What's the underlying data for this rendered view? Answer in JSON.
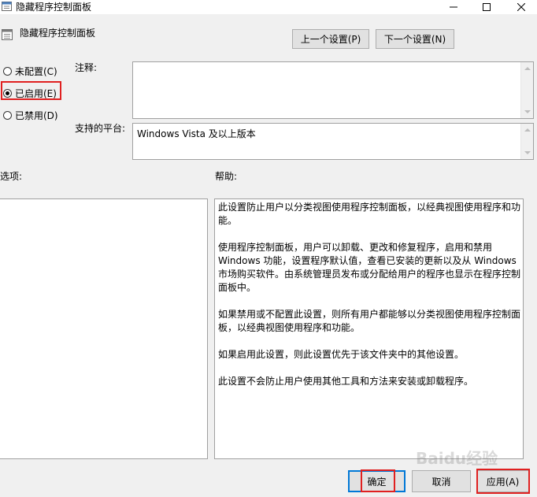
{
  "window": {
    "title": "隐藏程序控制面板",
    "controls": [
      "minimize-icon",
      "maximize-icon",
      "close-icon"
    ]
  },
  "header": {
    "policy_name": "隐藏程序控制面板",
    "prev_button": "上一个设置(P)",
    "next_button": "下一个设置(N)"
  },
  "state": {
    "options": [
      {
        "label": "未配置(C)",
        "selected": false
      },
      {
        "label": "已启用(E)",
        "selected": true
      },
      {
        "label": "已禁用(D)",
        "selected": false
      }
    ]
  },
  "comment": {
    "label": "注释:",
    "value": ""
  },
  "platform": {
    "label": "支持的平台:",
    "value": "Windows Vista 及以上版本"
  },
  "options_section": {
    "label": "选项:"
  },
  "help": {
    "label": "帮助:",
    "paragraphs": [
      "此设置防止用户以分类视图使用程序控制面板，以经典视图使用程序和功能。",
      "使用程序控制面板，用户可以卸载、更改和修复程序，启用和禁用 Windows 功能，设置程序默认值，查看已安装的更新以及从 Windows 市场购买软件。由系统管理员发布或分配给用户的程序也显示在程序控制面板中。",
      "如果禁用或不配置此设置，则所有用户都能够以分类视图使用程序控制面板，以经典视图使用程序和功能。",
      "如果启用此设置，则此设置优先于该文件夹中的其他设置。",
      "此设置不会防止用户使用其他工具和方法来安装或卸载程序。"
    ]
  },
  "footer": {
    "ok_button": "确定",
    "cancel_button": "取消",
    "apply_button": "应用(A)"
  },
  "watermark": "Baidu经验",
  "colors": {
    "highlight_red": "#e02020",
    "focus_blue": "#0078d7",
    "dialog_bg": "#f0f0f0"
  }
}
